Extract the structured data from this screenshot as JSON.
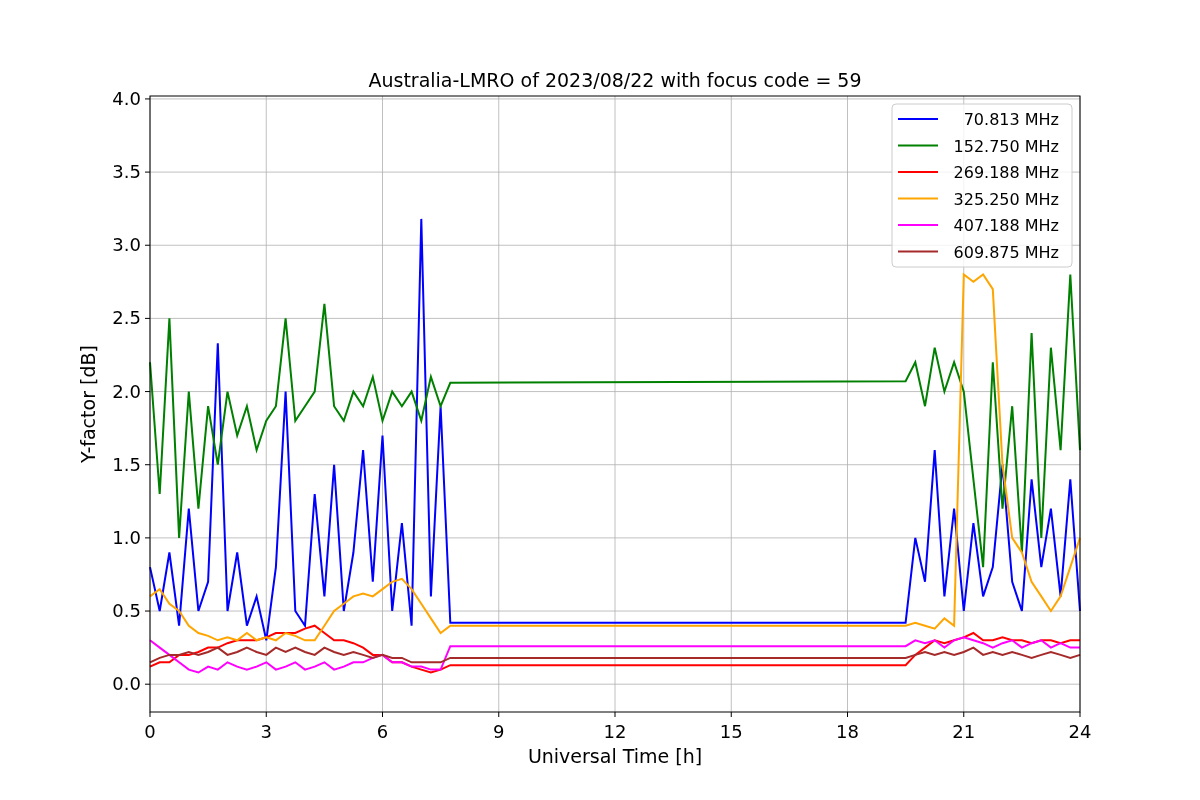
{
  "figure": {
    "chart_data": {
      "type": "line",
      "title": "Australia-LMRO of 2023/08/22 with focus code = 59",
      "xlabel": "Universal Time [h]",
      "ylabel": "Y-factor [dB]",
      "x": [
        0,
        0.25,
        0.5,
        0.75,
        1,
        1.25,
        1.5,
        1.75,
        2,
        2.25,
        2.5,
        2.75,
        3,
        3.25,
        3.5,
        3.75,
        4,
        4.25,
        4.5,
        4.75,
        5,
        5.25,
        5.5,
        5.75,
        6,
        6.25,
        6.5,
        6.75,
        7,
        7.25,
        7.5,
        7.75,
        19.5,
        19.75,
        20,
        20.25,
        20.5,
        20.75,
        21,
        21.25,
        21.5,
        21.75,
        22,
        22.25,
        22.5,
        22.75,
        23,
        23.25,
        23.5,
        23.75,
        24
      ],
      "series": [
        {
          "name": "70.813 MHz",
          "color": "#0000ff",
          "values": [
            0.8,
            0.5,
            0.9,
            0.4,
            1.2,
            0.5,
            0.7,
            2.33,
            0.5,
            0.9,
            0.4,
            0.6,
            0.3,
            0.8,
            2.0,
            0.5,
            0.4,
            1.3,
            0.6,
            1.5,
            0.5,
            0.9,
            1.6,
            0.7,
            1.7,
            0.5,
            1.1,
            0.4,
            3.18,
            0.6,
            1.9,
            0.42,
            0.42,
            1.0,
            0.7,
            1.6,
            0.6,
            1.2,
            0.5,
            1.1,
            0.6,
            0.8,
            1.5,
            0.7,
            0.5,
            1.4,
            0.8,
            1.2,
            0.6,
            1.4,
            0.5
          ]
        },
        {
          "name": "152.750 MHz",
          "color": "#008000",
          "values": [
            2.2,
            1.3,
            2.5,
            1.0,
            2.0,
            1.2,
            1.9,
            1.5,
            2.0,
            1.7,
            1.9,
            1.6,
            1.8,
            1.9,
            2.5,
            1.8,
            1.9,
            2.0,
            2.6,
            1.9,
            1.8,
            2.0,
            1.9,
            2.1,
            1.8,
            2.0,
            1.9,
            2.0,
            1.8,
            2.1,
            1.9,
            2.06,
            2.07,
            2.2,
            1.9,
            2.3,
            2.0,
            2.2,
            2.0,
            1.4,
            0.8,
            2.2,
            1.2,
            1.9,
            0.9,
            2.4,
            1.0,
            2.3,
            1.6,
            2.8,
            1.6
          ]
        },
        {
          "name": "269.188 MHz",
          "color": "#ff0000",
          "values": [
            0.12,
            0.15,
            0.15,
            0.2,
            0.2,
            0.22,
            0.25,
            0.25,
            0.28,
            0.3,
            0.3,
            0.3,
            0.32,
            0.35,
            0.35,
            0.35,
            0.38,
            0.4,
            0.35,
            0.3,
            0.3,
            0.28,
            0.25,
            0.2,
            0.2,
            0.15,
            0.15,
            0.12,
            0.1,
            0.08,
            0.1,
            0.13,
            0.13,
            0.2,
            0.25,
            0.3,
            0.28,
            0.3,
            0.32,
            0.35,
            0.3,
            0.3,
            0.32,
            0.3,
            0.3,
            0.28,
            0.3,
            0.3,
            0.28,
            0.3,
            0.3
          ]
        },
        {
          "name": "325.250 MHz",
          "color": "#ffa500",
          "values": [
            0.6,
            0.65,
            0.55,
            0.5,
            0.4,
            0.35,
            0.33,
            0.3,
            0.32,
            0.3,
            0.35,
            0.3,
            0.32,
            0.3,
            0.35,
            0.33,
            0.3,
            0.3,
            0.4,
            0.5,
            0.55,
            0.6,
            0.62,
            0.6,
            0.65,
            0.7,
            0.72,
            0.65,
            0.55,
            0.45,
            0.35,
            0.4,
            0.4,
            0.42,
            0.4,
            0.38,
            0.45,
            0.4,
            2.8,
            2.75,
            2.8,
            2.7,
            1.5,
            1.0,
            0.9,
            0.7,
            0.6,
            0.5,
            0.6,
            0.8,
            1.0
          ]
        },
        {
          "name": "407.188 MHz",
          "color": "#ff00ff",
          "values": [
            0.3,
            0.25,
            0.2,
            0.15,
            0.1,
            0.08,
            0.12,
            0.1,
            0.15,
            0.12,
            0.1,
            0.12,
            0.15,
            0.1,
            0.12,
            0.15,
            0.1,
            0.12,
            0.15,
            0.1,
            0.12,
            0.15,
            0.15,
            0.18,
            0.2,
            0.15,
            0.15,
            0.12,
            0.12,
            0.1,
            0.1,
            0.26,
            0.26,
            0.3,
            0.28,
            0.3,
            0.25,
            0.3,
            0.32,
            0.3,
            0.28,
            0.25,
            0.28,
            0.3,
            0.25,
            0.28,
            0.3,
            0.25,
            0.28,
            0.25,
            0.25
          ]
        },
        {
          "name": "609.875 MHz",
          "color": "#a52a2a",
          "values": [
            0.15,
            0.18,
            0.2,
            0.2,
            0.22,
            0.2,
            0.22,
            0.25,
            0.2,
            0.22,
            0.25,
            0.22,
            0.2,
            0.25,
            0.22,
            0.25,
            0.22,
            0.2,
            0.25,
            0.22,
            0.2,
            0.22,
            0.2,
            0.18,
            0.2,
            0.18,
            0.18,
            0.15,
            0.15,
            0.15,
            0.15,
            0.18,
            0.18,
            0.2,
            0.22,
            0.2,
            0.22,
            0.2,
            0.22,
            0.25,
            0.2,
            0.22,
            0.2,
            0.22,
            0.2,
            0.18,
            0.2,
            0.22,
            0.2,
            0.18,
            0.2
          ]
        }
      ],
      "grid": true,
      "legend": true,
      "xlim": [
        0,
        24
      ],
      "ylim": [
        -0.19,
        4.02
      ],
      "xticks": [
        0,
        3,
        6,
        9,
        12,
        15,
        18,
        21,
        24
      ],
      "yticks": [
        {
          "value": 0,
          "label": "0.0"
        },
        {
          "value": 0.5,
          "label": "0.5"
        },
        {
          "value": 1,
          "label": "1.0"
        },
        {
          "value": 1.5,
          "label": "1.5"
        },
        {
          "value": 2,
          "label": "2.0"
        },
        {
          "value": 2.5,
          "label": "2.5"
        },
        {
          "value": 3,
          "label": "3.0"
        },
        {
          "value": 3.5,
          "label": "3.5"
        },
        {
          "value": 4,
          "label": "4.0"
        }
      ]
    }
  }
}
